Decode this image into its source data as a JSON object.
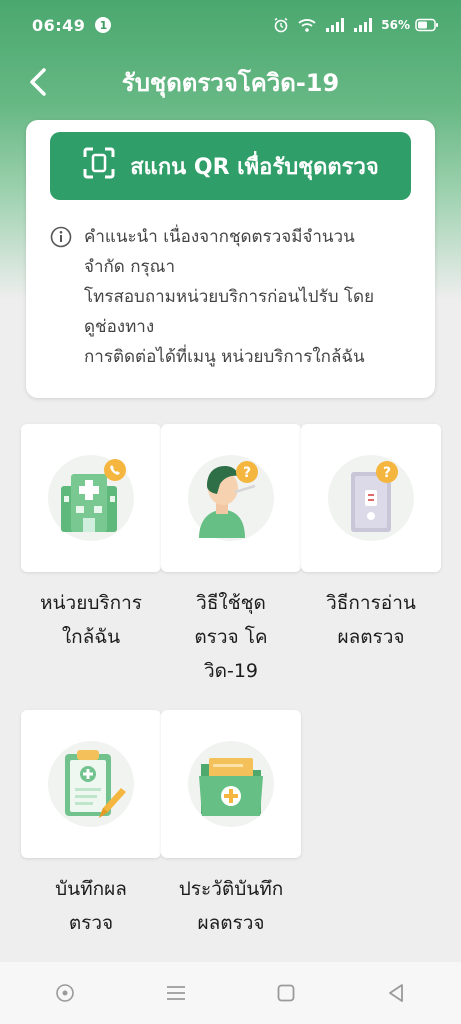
{
  "status_bar": {
    "time": "06:49",
    "notification_count": "1",
    "battery": "56%"
  },
  "header": {
    "title": "รับชุดตรวจโควิด-19"
  },
  "scan": {
    "label": "สแกน QR เพื่อรับชุดตรวจ"
  },
  "note": {
    "lines": [
      "คำแนะนำ  เนื่องจากชุดตรวจมีจำนวน",
      "จำกัด  กรุณา",
      "โทรสอบถามหน่วยบริการก่อนไปรับ  โดย",
      "ดูช่องทาง",
      "การติดต่อได้ที่เมนู  หน่วยบริการใกล้ฉัน"
    ]
  },
  "menu": {
    "nearby_service": {
      "line1": "หน่วยบริการ",
      "line2": "ใกล้ฉัน",
      "icon": "hospital-icon"
    },
    "how_to_use": {
      "line1": "วิธีใช้ชุด",
      "line2": "ตรวจ โค",
      "line3": "วิด-19",
      "icon": "swab-test-icon"
    },
    "how_to_read": {
      "line1": "วิธีการอ่าน",
      "line2": "ผลตรวจ",
      "icon": "test-kit-icon"
    },
    "record_result": {
      "line1": "บันทึกผล",
      "line2": "ตรวจ",
      "icon": "clipboard-icon"
    },
    "history": {
      "line1": "ประวัติบันทึก",
      "line2": "ผลตรวจ",
      "icon": "folder-icon"
    }
  },
  "colors": {
    "primary": "#2f9e68",
    "accent": "#f4b63e",
    "header_bg": "#4aa86f"
  }
}
